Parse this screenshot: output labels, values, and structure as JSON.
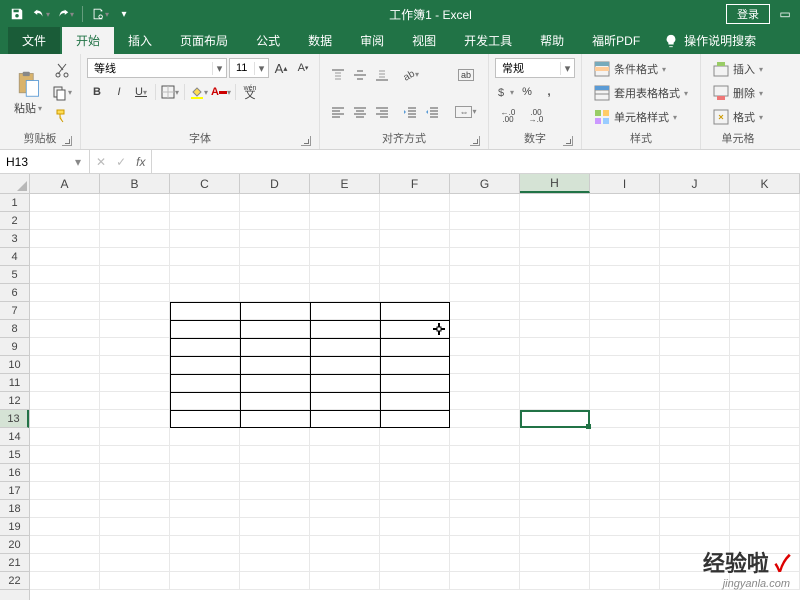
{
  "titlebar": {
    "title": "工作簿1 - Excel",
    "login": "登录"
  },
  "tabs": {
    "file": "文件",
    "home": "开始",
    "insert": "插入",
    "layout": "页面布局",
    "formulas": "公式",
    "data": "数据",
    "review": "审阅",
    "view": "视图",
    "dev": "开发工具",
    "help": "帮助",
    "foxit": "福昕PDF",
    "tellme": "操作说明搜索"
  },
  "ribbon": {
    "clipboard": {
      "paste": "粘贴",
      "label": "剪贴板"
    },
    "font": {
      "name": "等线",
      "size": "11",
      "bold": "B",
      "italic": "I",
      "underline": "U",
      "label": "字体",
      "ruby_top": "wén",
      "ruby_bottom": "文"
    },
    "align": {
      "wrap": "ab",
      "merge_icon": "⇔",
      "label": "对齐方式"
    },
    "number": {
      "format": "常规",
      "percent": "%",
      "comma": ",",
      "inc": ".0",
      "inc2": ".00",
      "dec": ".00",
      "dec2": ".0",
      "label": "数字"
    },
    "styles": {
      "cond": "条件格式",
      "table": "套用表格格式",
      "cell": "单元格样式",
      "label": "样式"
    },
    "cells": {
      "insert": "插入",
      "delete": "删除",
      "format": "格式",
      "label": "单元格"
    }
  },
  "fbar": {
    "name": "H13",
    "cancel": "✕",
    "enter": "✓",
    "fx": "fx"
  },
  "grid": {
    "cols": [
      "A",
      "B",
      "C",
      "D",
      "E",
      "F",
      "G",
      "H",
      "I",
      "J",
      "K"
    ],
    "rows": [
      "1",
      "2",
      "3",
      "4",
      "5",
      "6",
      "7",
      "8",
      "9",
      "10",
      "11",
      "12",
      "13",
      "14",
      "15",
      "16",
      "17",
      "18",
      "19",
      "20",
      "21",
      "22"
    ],
    "selected_col": "H",
    "selected_row": "13",
    "border_region": {
      "start_col": "C",
      "end_col": "F",
      "start_row": "7",
      "end_row": "13"
    }
  },
  "watermark": {
    "text": "经验啦",
    "check": "✓",
    "url": "jingyanla.com"
  }
}
